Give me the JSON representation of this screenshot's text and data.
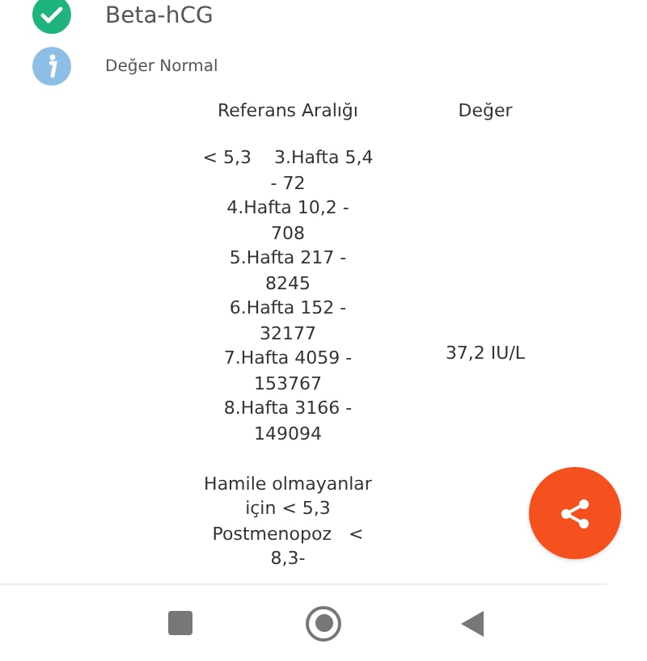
{
  "test": {
    "title": "Beta-hCG",
    "status": "Değer Normal"
  },
  "table": {
    "columns": [
      "Referans Aralığı",
      "Değer"
    ],
    "reference_lines": [
      "< 5,3    3.Hafta 5,4",
      "- 72",
      "4.Hafta 10,2 -",
      "708",
      "5.Hafta 217 -",
      "8245",
      "6.Hafta 152 -",
      "32177",
      "7.Hafta 4059 -",
      "153767",
      "8.Hafta 3166 -",
      "149094"
    ],
    "note_lines": [
      "Hamile olmayanlar",
      "için < 5,3",
      "Postmenopoz   <",
      "8,3-"
    ],
    "value": "37,2 IU/L"
  }
}
